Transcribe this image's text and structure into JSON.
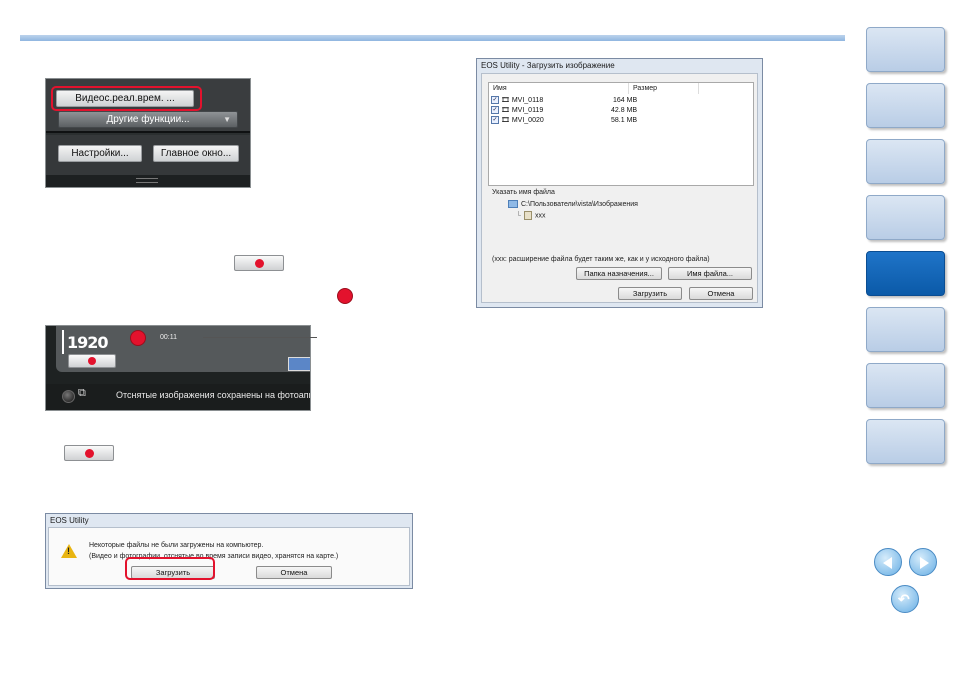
{
  "panel1": {
    "video_btn": "Видеос.реал.врем. ...",
    "other_btn": "Другие функции...",
    "settings_btn": "Настройки...",
    "main_btn": "Главное окно..."
  },
  "panel2": {
    "resolution": "1920",
    "timer": "00:11",
    "message": "Отснятые изображения сохранены на фотоаппарат."
  },
  "download_window": {
    "title": "EOS Utility - Загрузить изображение",
    "col_name": "Имя",
    "col_size": "Размер",
    "files": [
      {
        "name": "MVI_0118",
        "size": "164 MB"
      },
      {
        "name": "MVI_0119",
        "size": "42.8 MB"
      },
      {
        "name": "MVI_0020",
        "size": "58.1 MB"
      }
    ],
    "filename_label": "Указать имя файла",
    "path": "C:\\Пользователи\\vista\\Изображения",
    "ext": "xxx",
    "note": "(xxx: расширение файла будет таким же, как и у исходного файла)",
    "dest_btn": "Папка назначения...",
    "name_btn": "Имя файла...",
    "download_btn": "Загрузить",
    "cancel_btn": "Отмена"
  },
  "alert_window": {
    "title": "EOS Utility",
    "line1": "Некоторые файлы не были загружены на компьютер.",
    "line2": "(Видео и фотографии, отснятые во время записи видео, хранятся на карте.)",
    "download_btn": "Загрузить",
    "cancel_btn": "Отмена"
  },
  "colors": {
    "accent_red": "#e3122d",
    "nav_active": "#0b5aa8",
    "top_bar": "#9cbfe5"
  },
  "nav": {
    "tabs": [
      "tab",
      "tab",
      "tab",
      "tab",
      "tab-active",
      "tab",
      "tab",
      "tab"
    ],
    "icons": [
      "prev-page-icon",
      "next-page-icon",
      "return-icon"
    ]
  }
}
